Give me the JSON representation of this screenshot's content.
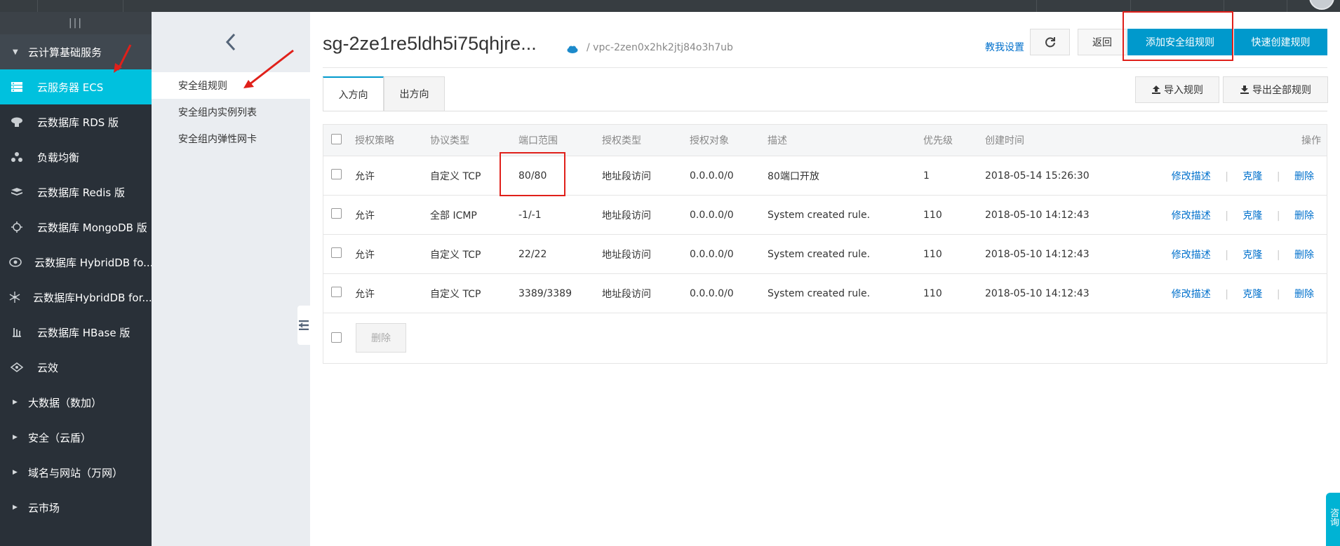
{
  "sidebar": {
    "handle": "|||",
    "group_label": "云计算基础服务",
    "items": [
      {
        "label": "云服务器 ECS",
        "icon": "server-icon"
      },
      {
        "label": "云数据库 RDS 版",
        "icon": "database-icon"
      },
      {
        "label": "负载均衡",
        "icon": "load-balancer-icon"
      },
      {
        "label": "云数据库 Redis 版",
        "icon": "redis-icon"
      },
      {
        "label": "云数据库 MongoDB 版",
        "icon": "mongodb-icon"
      },
      {
        "label": "云数据库 HybridDB fo...",
        "icon": "hybriddb-icon"
      },
      {
        "label": "云数据库HybridDB for...",
        "icon": "hybriddb-cluster-icon"
      },
      {
        "label": "云数据库 HBase 版",
        "icon": "hbase-icon"
      },
      {
        "label": "云效",
        "icon": "devops-icon"
      }
    ],
    "sub_groups": [
      "大数据（数加）",
      "安全（云盾）",
      "域名与网站（万网）",
      "云市场"
    ]
  },
  "submenu": {
    "items": [
      "安全组规则",
      "安全组内实例列表",
      "安全组内弹性网卡"
    ]
  },
  "header": {
    "title": "sg-2ze1re5ldh5i75qhjre...",
    "vpc": "/  vpc-2zen0x2hk2jtj84o3h7ub",
    "help_link": "教我设置",
    "back_label": "返回",
    "add_rule_label": "添加安全组规则",
    "quick_create_label": "快速创建规则"
  },
  "tabs": [
    "入方向",
    "出方向"
  ],
  "toolbar": {
    "import_label": "导入规则",
    "export_label": "导出全部规则"
  },
  "table": {
    "columns": [
      "授权策略",
      "协议类型",
      "端口范围",
      "授权类型",
      "授权对象",
      "描述",
      "优先级",
      "创建时间",
      "操作"
    ],
    "actions": [
      "修改描述",
      "克隆",
      "删除"
    ],
    "rows": [
      {
        "policy": "允许",
        "protocol": "自定义 TCP",
        "port": "80/80",
        "auth_type": "地址段访问",
        "target": "0.0.0.0/0",
        "desc": "80端口开放",
        "priority": "1",
        "created": "2018-05-14 15:26:30"
      },
      {
        "policy": "允许",
        "protocol": "全部 ICMP",
        "port": "-1/-1",
        "auth_type": "地址段访问",
        "target": "0.0.0.0/0",
        "desc": "System created rule.",
        "priority": "110",
        "created": "2018-05-10 14:12:43"
      },
      {
        "policy": "允许",
        "protocol": "自定义 TCP",
        "port": "22/22",
        "auth_type": "地址段访问",
        "target": "0.0.0.0/0",
        "desc": "System created rule.",
        "priority": "110",
        "created": "2018-05-10 14:12:43"
      },
      {
        "policy": "允许",
        "protocol": "自定义 TCP",
        "port": "3389/3389",
        "auth_type": "地址段访问",
        "target": "0.0.0.0/0",
        "desc": "System created rule.",
        "priority": "110",
        "created": "2018-05-10 14:12:43"
      }
    ],
    "delete_label": "删除"
  },
  "consult": "咨询",
  "colors": {
    "accent": "#0099cc",
    "sidebar_active": "#00c1de",
    "annotation_red": "#e0201a"
  }
}
